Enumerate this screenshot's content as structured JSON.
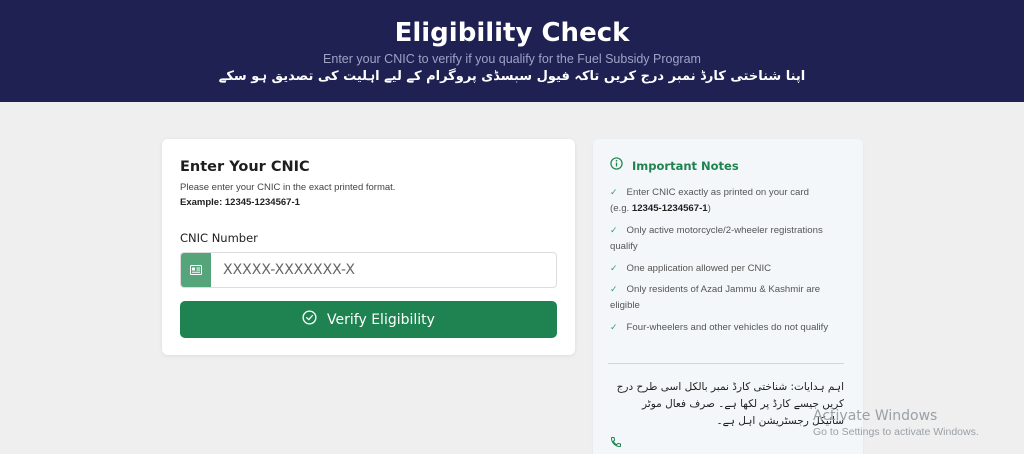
{
  "header": {
    "title": "Eligibility Check",
    "subtitle_en": "Enter your CNIC to verify if you qualify for the Fuel Subsidy Program",
    "subtitle_ur": "اپنا شناختی کارڈ نمبر درج کریں تاکہ فیول سبسڈی پروگرام کے لیے اہلیت کی تصدیق ہو سکے"
  },
  "form": {
    "title": "Enter Your CNIC",
    "hint": "Please enter your CNIC in the exact printed format.",
    "example": "Example: 12345-1234567-1",
    "field_label": "CNIC Number",
    "input_value": "",
    "input_placeholder": "XXXXX-XXXXXXX-X",
    "submit_label": "Verify Eligibility",
    "icons": {
      "input": "id-card-icon",
      "submit": "check-circle-icon"
    }
  },
  "notes": {
    "title": "Important Notes",
    "items": [
      {
        "text": "Enter CNIC exactly as printed on your card",
        "extra_prefix": "(e.g. ",
        "extra_bold": "12345-1234567-1",
        "extra_suffix": ")"
      },
      {
        "text": "Only active motorcycle/2-wheeler registrations qualify"
      },
      {
        "text": "One application allowed per CNIC"
      },
      {
        "text": "Only residents of Azad Jammu & Kashmir are eligible"
      },
      {
        "text": "Four-wheelers and other vehicles do not qualify"
      }
    ],
    "urdu_note": "اہم ہدایات: شناختی کارڈ نمبر بالکل اسی طرح درج کریں جیسے کارڈ پر لکھا ہے۔ صرف فعال موٹر سائیکل رجسٹریشن اہل ہے۔",
    "icons": {
      "header": "info-icon",
      "check": "check-icon",
      "contact": "phone-icon"
    }
  },
  "os_watermark": {
    "line1": "Activate Windows",
    "line2": "Go to Settings to activate Windows."
  },
  "colors": {
    "header_bg": "#1e2152",
    "primary_green": "#1e8350",
    "icon_green": "#56a57a",
    "page_bg": "#efefef",
    "notes_bg": "#f4f7f9"
  }
}
